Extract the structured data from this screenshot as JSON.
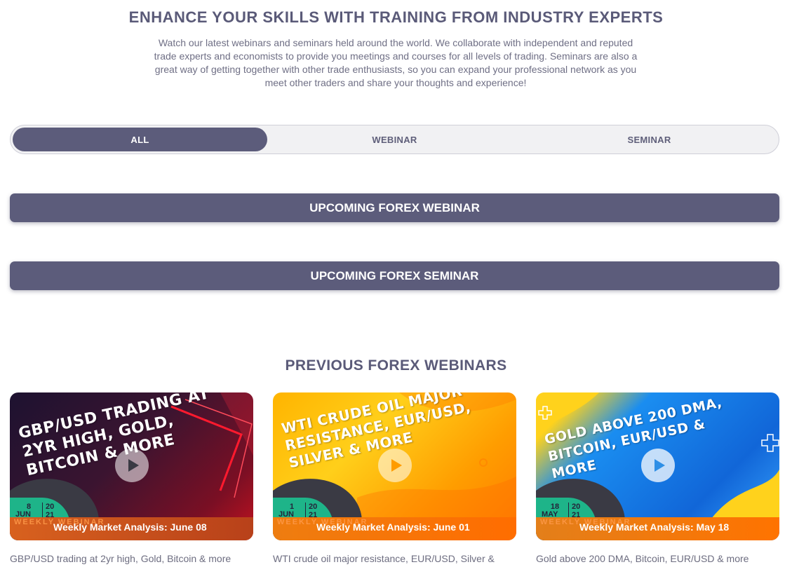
{
  "header": {
    "headline": "ENHANCE YOUR SKILLS WITH TRAINING FROM INDUSTRY EXPERTS",
    "intro": "Watch our latest webinars and seminars held around the world. We collaborate with independent and reputed trade experts and economists to provide you meetings and courses for all levels of trading. Seminars are also a great way of getting together with other trade enthusiasts, so you can expand your professional network as you meet other traders and share your thoughts and experience!"
  },
  "filter_tabs": {
    "all": "ALL",
    "webinar": "WEBINAR",
    "seminar": "SEMINAR",
    "active": "ALL"
  },
  "upcoming": {
    "webinar_label": "UPCOMING FOREX WEBINAR",
    "seminar_label": "UPCOMING FOREX SEMINAR"
  },
  "previous": {
    "title": "PREVIOUS FOREX WEBINARS",
    "cards": [
      {
        "headline": "GBP/USD TRADING AT 2YR HIGH, GOLD, BITCOIN & MORE",
        "day": "8",
        "month": "JUN",
        "year": "20 21",
        "tag": "WEEKLY WEBINAR",
        "caption": "Weekly Market Analysis: June 08",
        "description": "GBP/USD trading at 2yr high, Gold, Bitcoin & more"
      },
      {
        "headline": "WTI CRUDE OIL MAJOR RESISTANCE, EUR/USD, SILVER & MORE",
        "day": "1",
        "month": "JUN",
        "year": "20 21",
        "tag": "WEEKLY WEBINAR",
        "caption": "Weekly Market Analysis: June 01",
        "description": "WTI crude oil major resistance, EUR/USD, Silver &"
      },
      {
        "headline": "GOLD ABOVE 200 DMA, BITCOIN, EUR/USD & MORE",
        "day": "18",
        "month": "MAY",
        "year": "20 21",
        "tag": "WEEKLY WEBINAR",
        "caption": "Weekly Market Analysis: May 18",
        "description": "Gold above 200 DMA, Bitcoin, EUR/USD & more"
      }
    ]
  },
  "colors": {
    "primary": "#5c5c7b",
    "accent_orange": "#ff7300",
    "badge_green": "#1eb489"
  },
  "icons": {
    "play": "play-icon"
  }
}
